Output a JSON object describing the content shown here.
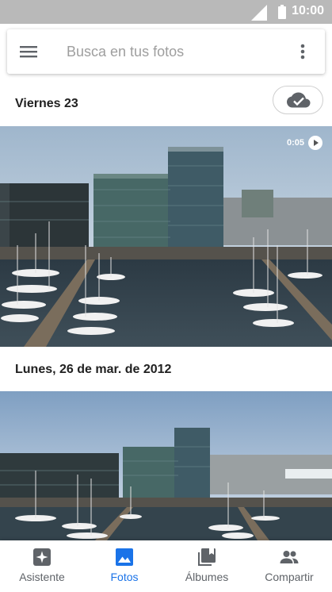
{
  "status_bar": {
    "time": "10:00"
  },
  "search": {
    "placeholder": "Busca en tus fotos"
  },
  "sections": [
    {
      "date": "Viernes 23",
      "video_duration": "0:05"
    },
    {
      "date": "Lunes, 26 de mar. de 2012"
    }
  ],
  "bottom_nav": {
    "items": [
      {
        "label": "Asistente",
        "icon": "assistant-icon"
      },
      {
        "label": "Fotos",
        "icon": "photos-icon",
        "active": true
      },
      {
        "label": "Álbumes",
        "icon": "albums-icon"
      },
      {
        "label": "Compartir",
        "icon": "share-icon"
      }
    ]
  },
  "colors": {
    "accent": "#1a73e8",
    "status_bar": "#b9b9b9"
  }
}
